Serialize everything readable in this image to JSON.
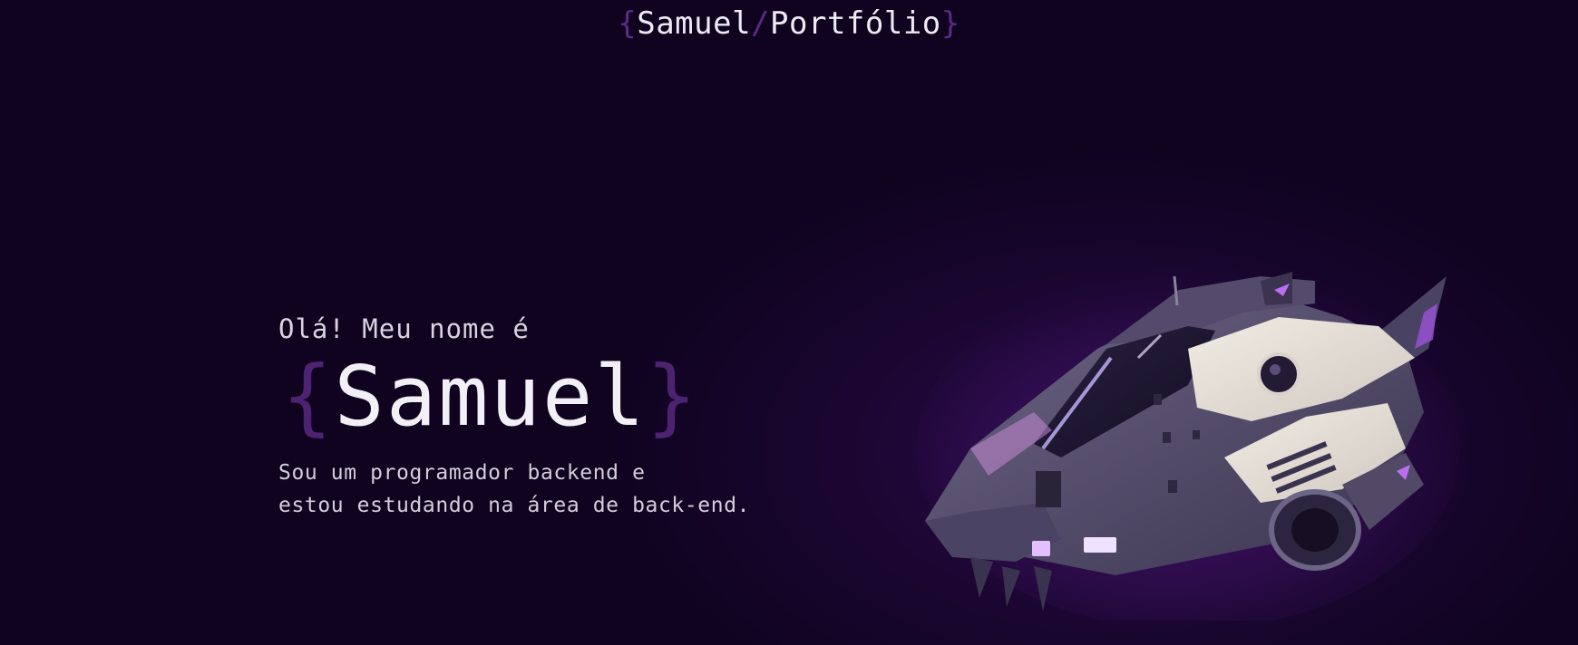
{
  "header": {
    "brace_open": "{",
    "name": "Samuel",
    "slash": "/",
    "section": "Portfólio",
    "brace_close": "}"
  },
  "hero": {
    "greeting": "Olá! Meu nome é",
    "name_brace_open": "{",
    "name": "Samuel",
    "name_brace_close": "}",
    "description_line1": "Sou um programador backend e",
    "description_line2": "estou estudando na área de back-end."
  },
  "colors": {
    "background": "#0f0320",
    "accent_purple": "#5a2a85",
    "glow_purple": "#a24bd6",
    "text": "#eeeaf3"
  },
  "icons": {
    "hero_image": "spaceship-illustration"
  }
}
